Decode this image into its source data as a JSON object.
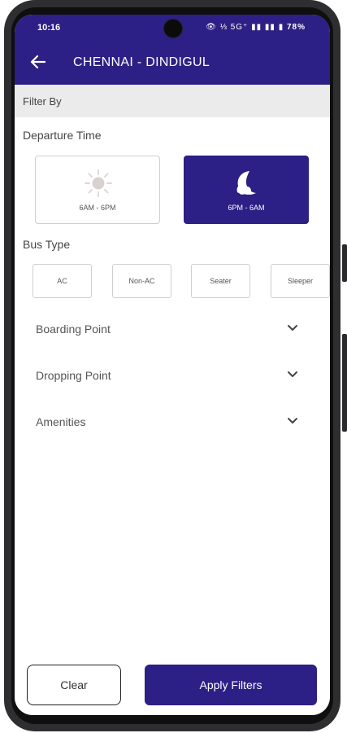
{
  "status_bar": {
    "time": "10:16",
    "indicators": "👁 ⅓ 5G⁺ ▮▮ ▮▮",
    "battery": "78%"
  },
  "app_bar": {
    "title": "CHENNAI - DINDIGUL",
    "back_icon": "arrow-left-icon"
  },
  "filter_header": "Filter By",
  "departure_time": {
    "title": "Departure Time",
    "options": [
      {
        "label": "6AM - 6PM",
        "icon": "sun-icon",
        "selected": false
      },
      {
        "label": "6PM - 6AM",
        "icon": "moon-icon",
        "selected": true
      }
    ]
  },
  "bus_type": {
    "title": "Bus Type",
    "options": [
      "AC",
      "Non-AC",
      "Seater",
      "Sleeper"
    ]
  },
  "accordions": [
    {
      "label": "Boarding Point"
    },
    {
      "label": "Dropping Point"
    },
    {
      "label": "Amenities"
    }
  ],
  "actions": {
    "clear_label": "Clear",
    "apply_label": "Apply Filters"
  },
  "colors": {
    "primary": "#2c1f85",
    "header_bg": "#ebebeb"
  }
}
